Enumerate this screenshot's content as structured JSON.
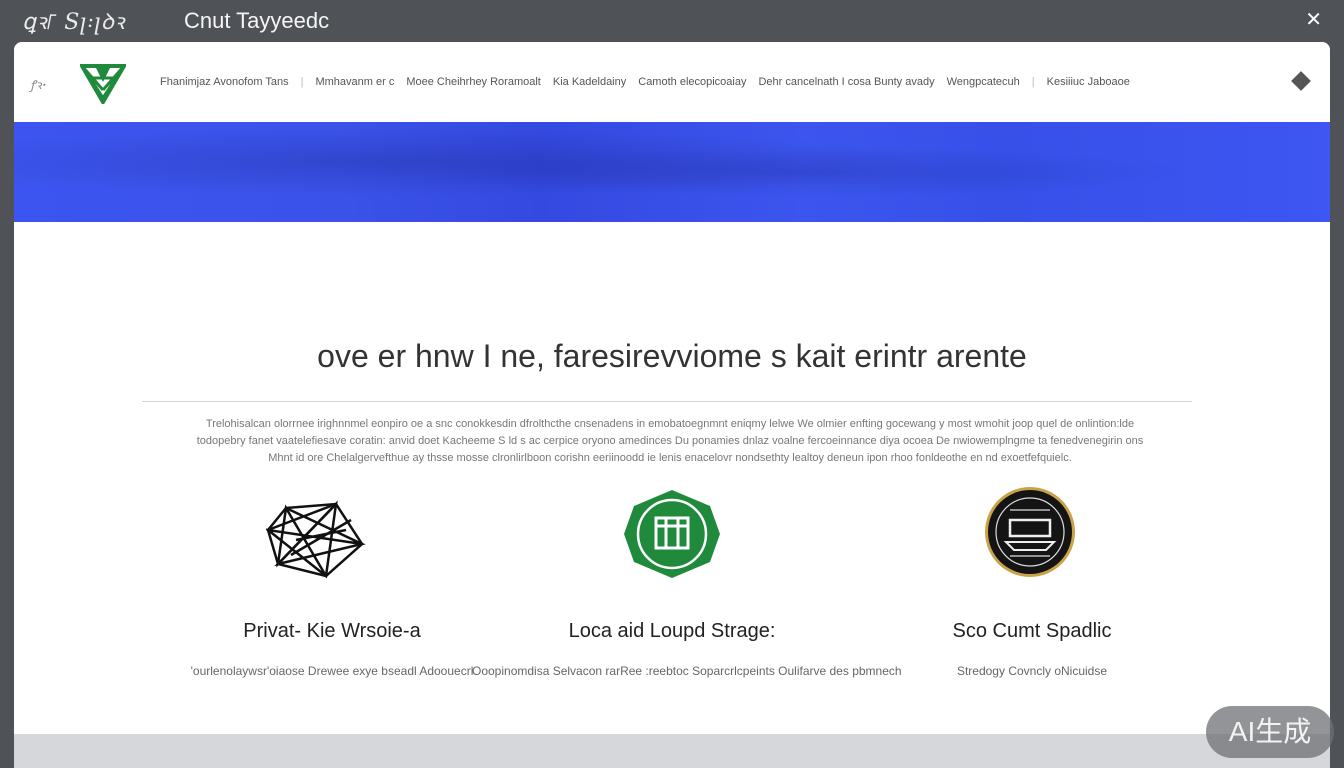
{
  "topbar": {
    "brand": "ꝗꝛ꜒ Sꞁ꞉ꞁꝺꝛ",
    "title": "Cnut Tayyeedc",
    "close_icon": "close-icon"
  },
  "nav": {
    "lang": "ꝭꝛꞏ",
    "logo_color": "#1f8a3c",
    "items": [
      "Fhanimjaz Avonofom Tans",
      "Mmhavanm er c",
      "Moee Cheihrhey Roramoalt",
      "Kia Kadeldainy",
      "Camoth elecopicoaiay",
      "Dehr cancelnath I cosa Bunty avady",
      "Wengpcatecuh",
      "Kesiiiuc Jaboaoe"
    ],
    "menu_icon": "diamond-icon"
  },
  "banner": {
    "color": "#3a52ec"
  },
  "main": {
    "headline": "ove er hnw  I ne, faresirevviome s kait erintr arente",
    "intro_lines": [
      "Trelohisalcan olorrnee irighnnmel eonpiro oe a snc conokkesdin dfrolthcthe cnsenadens in emobatoegnmnt eniqmy lelwe We olmier enfting gocewang y most wmohit joop quel de onlintion:lde",
      "todopebry fanet vaatelefiesave coratin: anvid doet Kacheeme S ld s ac cerpice oryono amedinces Du ponamies dnlaz voalne fercoeinnance diya ocoea De nwiowemplngme ta fenedvenegirin ons",
      "Mhnt id ore Chelalgervefthue ay thsse mosse clronlirlboon corishn eeriinoodd ie lenis enacelovr nondsethty lealtoy deneun ipon rhoo fonldeothe en nd exoetfefquielc."
    ]
  },
  "features": [
    {
      "title": "Privat- Kie Wrsoie-a",
      "desc": "'ourlenolaywsr'oiaose Drewee exye bseadl  Adoouecrl",
      "icon": "geometric-star-icon",
      "color": "#111111"
    },
    {
      "title": "Loca aid  Loupd Strage:",
      "desc": "Ooopinomdisa Selvacon rarRee :reebtoc Soparcrlcpeints Oulifarve des pbmnech",
      "icon": "green-shield-icon",
      "color": "#1f8a3c"
    },
    {
      "title": "Sco Cumt  Spadlic",
      "desc": "Stredogy Covncly oNicuidse",
      "icon": "black-seal-icon",
      "color": "#111111"
    }
  ],
  "watermark": "AI生成"
}
